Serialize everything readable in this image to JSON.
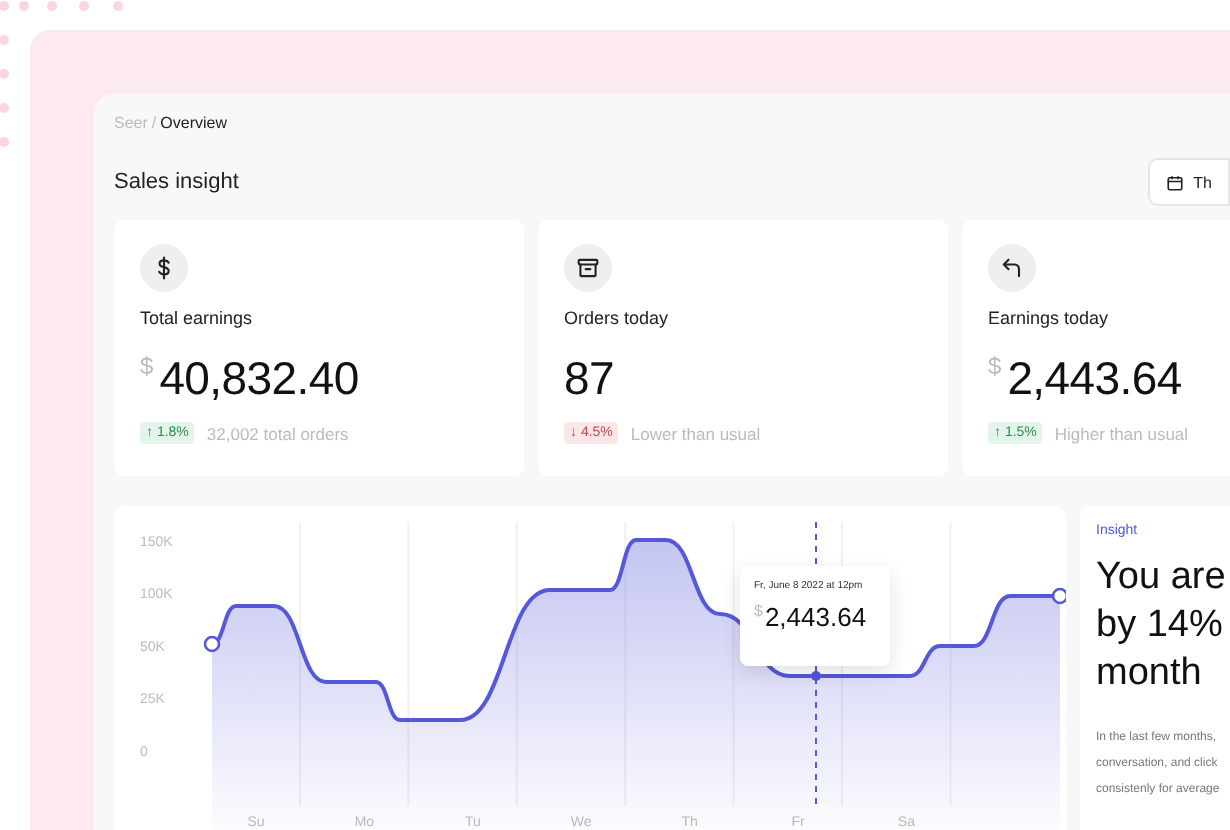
{
  "breadcrumb": {
    "parent": "Seer",
    "separator": "/",
    "current": "Overview"
  },
  "header": {
    "title": "Sales insight",
    "date_button": "Th"
  },
  "stats": [
    {
      "label": "Total earnings",
      "currency": "$",
      "value": "40,832.40",
      "negative": false,
      "change": "↑ 1.8%",
      "note": "32,002 total orders"
    },
    {
      "label": "Orders today",
      "value": "87",
      "negative": true,
      "change": "↓ 4.5%",
      "note": "Lower than usual"
    },
    {
      "label": "Earnings today",
      "currency": "$",
      "value": "2,443.64",
      "negative": false,
      "change": "↑ 1.5%",
      "note": "Higher than usual"
    }
  ],
  "sales_chart": {
    "y_labels": [
      "150K",
      "100K",
      "50K",
      "25K",
      "0"
    ],
    "x_labels": [
      "Su",
      "Mo",
      "Tu",
      "We",
      "Th",
      "Fr",
      "Sa"
    ],
    "tooltip": {
      "date": "Fr, June 8 2022 at 12pm",
      "currency": "$",
      "value": "2,443.64"
    }
  },
  "insight": {
    "tag": "Insight",
    "headline": [
      "You are",
      "by 14%",
      "month"
    ],
    "body": [
      "In the last few months,",
      "conversation, and click",
      "consistenly for average"
    ]
  }
}
